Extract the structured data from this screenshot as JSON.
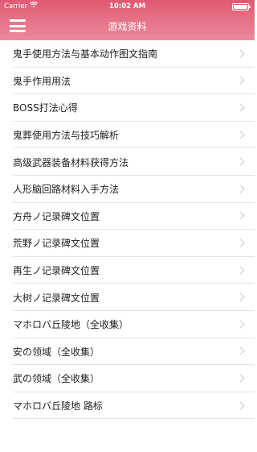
{
  "status_bar": {
    "carrier": "Carrier",
    "time": "10:02 AM"
  },
  "nav": {
    "title": "游戏资料",
    "menu_icon": "hamburger-menu-icon"
  },
  "colors": {
    "nav_gradient_top": "#e05a72",
    "nav_gradient_bottom": "#eb8a9b",
    "chevron": "#c7c7cc"
  },
  "list": {
    "items": [
      {
        "label": "鬼手使用方法与基本动作图文指南"
      },
      {
        "label": "鬼手作用用法"
      },
      {
        "label": "BOSS打法心得"
      },
      {
        "label": "鬼葬使用方法与技巧解析"
      },
      {
        "label": "高级武器装备材料获得方法"
      },
      {
        "label": "人形脑回路材料入手方法"
      },
      {
        "label": "方舟ノ记录碑文位置"
      },
      {
        "label": "荒野ノ记录碑文位置"
      },
      {
        "label": "再生ノ记录碑文位置"
      },
      {
        "label": "大树ノ记录碑文位置"
      },
      {
        "label": "マホロバ丘陵地（全收集）"
      },
      {
        "label": "安の领域（全收集）"
      },
      {
        "label": "武の领域（全收集）"
      },
      {
        "label": "マホロバ丘陵地 路标"
      }
    ]
  }
}
